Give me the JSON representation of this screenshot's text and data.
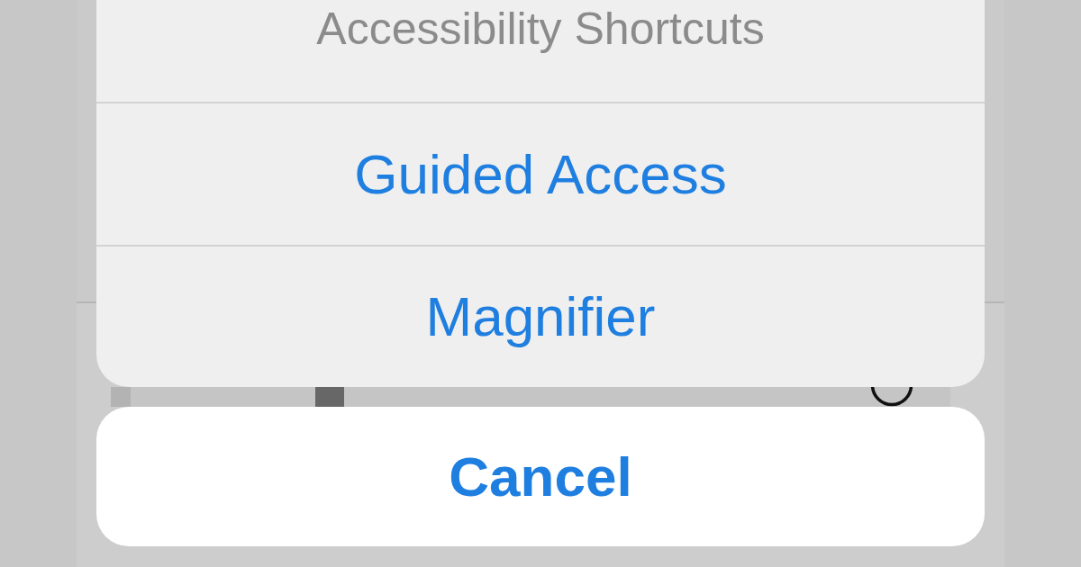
{
  "action_sheet": {
    "title": "Accessibility Shortcuts",
    "actions": [
      {
        "label": "Guided Access"
      },
      {
        "label": "Magnifier"
      }
    ]
  },
  "cancel_button": {
    "label": "Cancel"
  }
}
